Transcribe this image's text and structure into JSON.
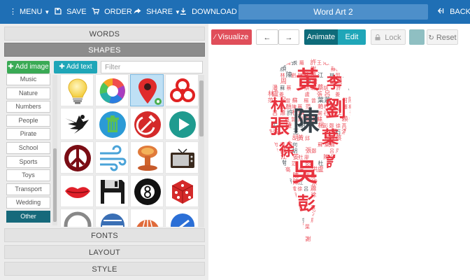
{
  "toolbar": {
    "menu": "MENU",
    "save": "SAVE",
    "order": "ORDER",
    "share": "SHARE",
    "download": "DOWNLOAD",
    "title": "Word Art 2",
    "back": "BACK"
  },
  "left_panel": {
    "sections": {
      "words": "WORDS",
      "shapes": "SHAPES",
      "fonts": "FONTS",
      "layout": "LAYOUT",
      "style": "STYLE"
    },
    "add_image": "Add image",
    "add_text": "Add text",
    "filter_placeholder": "Filter",
    "categories": [
      "Music",
      "Nature",
      "Numbers",
      "People",
      "Pirate",
      "School",
      "Sports",
      "Toys",
      "Transport",
      "Wedding",
      "Other"
    ],
    "selected_category": "Other",
    "shape_icons": [
      "lightbulb-icon",
      "aperture-icon",
      "map-pin-icon",
      "biohazard-icon",
      "eagle-icon",
      "recycle-bin-icon",
      "hammer-sickle-icon",
      "play-icon",
      "peace-icon",
      "wind-icon",
      "mushroom-cloud-icon",
      "tv-icon",
      "lips-icon",
      "floppy-disk-icon",
      "eight-ball-icon",
      "dice-icon",
      "circle-icon",
      "globe-icon",
      "shell-icon",
      "shield-icon"
    ],
    "selected_shape": "map-pin-icon"
  },
  "right_panel": {
    "visualize": "Visualize",
    "animate": "Animate",
    "edit": "Edit",
    "lock": "Lock",
    "reset": "Reset",
    "swatch_color": "#8fbfc2"
  },
  "word_art": {
    "shape": "map-pin",
    "colors": [
      "#e8333f",
      "#37424a"
    ],
    "words": [
      "黃",
      "李",
      "劉",
      "林",
      "張",
      "陳",
      "葉",
      "徐",
      "吳",
      "許",
      "彭",
      "鄭",
      "曾",
      "高",
      "王",
      "謝",
      "蔡",
      "邱",
      "楊",
      "周",
      "廖",
      "呂",
      "羅",
      "蘇",
      "郭",
      "何",
      "潘",
      "余",
      "江",
      "胡",
      "蕭",
      "賴",
      "鍾",
      "洪",
      "杜",
      "范",
      "姜",
      "顏",
      "盧",
      "石"
    ]
  }
}
